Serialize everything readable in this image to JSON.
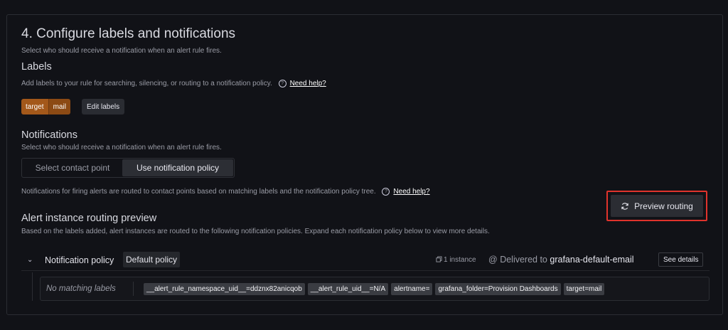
{
  "section": {
    "title": "4. Configure labels and notifications",
    "subtitle": "Select who should receive a notification when an alert rule fires."
  },
  "labels": {
    "heading": "Labels",
    "description": "Add labels to your rule for searching, silencing, or routing to a notification policy.",
    "help_link": "Need help?",
    "chip": {
      "key": "target",
      "value": "mail"
    },
    "edit_button": "Edit labels"
  },
  "notifications": {
    "heading": "Notifications",
    "subtitle": "Select who should receive a notification when an alert rule fires.",
    "options": [
      "Select contact point",
      "Use notification policy"
    ],
    "selected": "Use notification policy",
    "info": "Notifications for firing alerts are routed to contact points based on matching labels and the notification policy tree.",
    "help_link": "Need help?"
  },
  "routing_preview": {
    "heading": "Alert instance routing preview",
    "description": "Based on the labels added, alert instances are routed to the following notification policies. Expand each notification policy below to view more details.",
    "button": "Preview routing"
  },
  "policy": {
    "label": "Notification policy",
    "badge": "Default policy",
    "instances": "1 instance",
    "delivered_prefix": "Delivered to",
    "contact_point": "grafana-default-email",
    "see_details": "See details",
    "no_matching": "No matching labels",
    "instance_labels": [
      "__alert_rule_namespace_uid__=ddznx82anicqob",
      "__alert_rule_uid__=N/A",
      "alertname=",
      "grafana_folder=Provision Dashboards",
      "target=mail"
    ]
  },
  "colors": {
    "accent_chip": "#a3581a",
    "highlight_border": "#e0332c",
    "background": "#111217"
  }
}
